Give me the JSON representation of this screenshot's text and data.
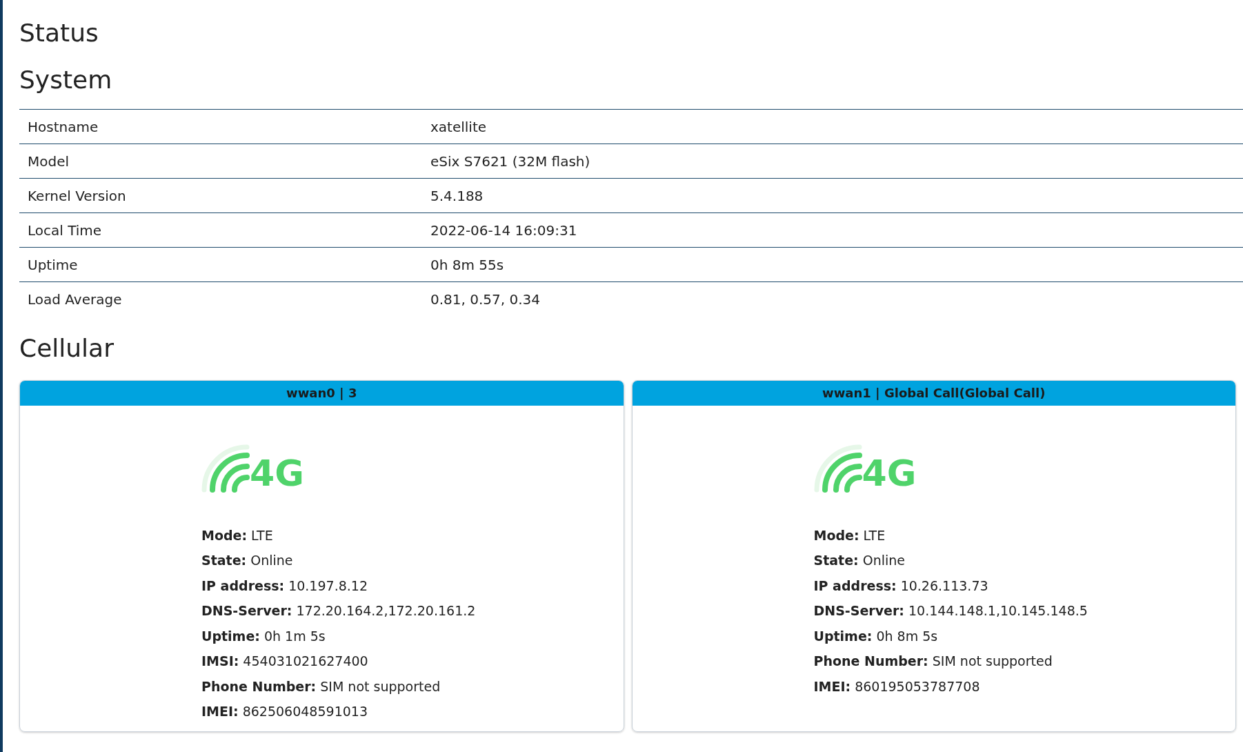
{
  "page_title": "Status",
  "system": {
    "title": "System",
    "rows": [
      {
        "label": "Hostname",
        "value": "xatellite"
      },
      {
        "label": "Model",
        "value": "eSix S7621 (32M flash)"
      },
      {
        "label": "Kernel Version",
        "value": "5.4.188"
      },
      {
        "label": "Local Time",
        "value": "2022-06-14 16:09:31"
      },
      {
        "label": "Uptime",
        "value": "0h 8m 55s"
      },
      {
        "label": "Load Average",
        "value": "0.81, 0.57, 0.34"
      }
    ]
  },
  "cellular": {
    "title": "Cellular",
    "cards": [
      {
        "title": "wwan0 | 3",
        "network_label": "4G",
        "details": [
          {
            "label": "Mode:",
            "value": "LTE"
          },
          {
            "label": "State:",
            "value": "Online"
          },
          {
            "label": "IP address:",
            "value": "10.197.8.12"
          },
          {
            "label": "DNS-Server:",
            "value": "172.20.164.2,172.20.161.2"
          },
          {
            "label": "Uptime:",
            "value": "0h 1m 5s"
          },
          {
            "label": "IMSI:",
            "value": "454031021627400"
          },
          {
            "label": "Phone Number:",
            "value": "SIM not supported"
          },
          {
            "label": "IMEI:",
            "value": "862506048591013"
          }
        ]
      },
      {
        "title": "wwan1 | Global Call(Global Call)",
        "network_label": "4G",
        "details": [
          {
            "label": "Mode:",
            "value": "LTE"
          },
          {
            "label": "State:",
            "value": "Online"
          },
          {
            "label": "IP address:",
            "value": "10.26.113.73"
          },
          {
            "label": "DNS-Server:",
            "value": "10.144.148.1,10.145.148.5"
          },
          {
            "label": "Uptime:",
            "value": "0h 8m 5s"
          },
          {
            "label": "Phone Number:",
            "value": "SIM not supported"
          },
          {
            "label": "IMEI:",
            "value": "860195053787708"
          }
        ]
      }
    ]
  }
}
